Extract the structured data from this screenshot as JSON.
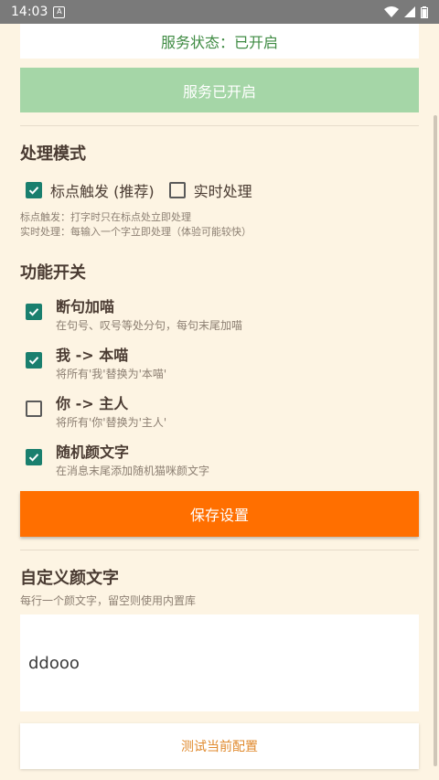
{
  "status_bar": {
    "time": "14:03",
    "notification_icon": "A"
  },
  "service": {
    "status_text": "服务状态：已开启",
    "button_label": "服务已开启"
  },
  "mode": {
    "title": "处理模式",
    "options": [
      {
        "label": "标点触发 (推荐)",
        "checked": true
      },
      {
        "label": "实时处理",
        "checked": false
      }
    ],
    "hints": [
      "标点触发：打字时只在标点处立即处理",
      "实时处理：每输入一个字立即处理（体验可能较快）"
    ]
  },
  "features": {
    "title": "功能开关",
    "items": [
      {
        "title": "断句加喵",
        "desc": "在句号、叹号等处分句，每句末尾加喵",
        "checked": true
      },
      {
        "title": "我 -> 本喵",
        "desc": "将所有'我'替换为'本喵'",
        "checked": true
      },
      {
        "title": "你 -> 主人",
        "desc": "将所有'你'替换为'主人'",
        "checked": false
      },
      {
        "title": "随机颜文字",
        "desc": "在消息末尾添加随机猫咪颜文字",
        "checked": true
      }
    ]
  },
  "save_button": "保存设置",
  "custom": {
    "title": "自定义颜文字",
    "hint": "每行一个颜文字，留空则使用内置库",
    "value": "ddooo"
  },
  "test_button": "测试当前配置",
  "colors": {
    "background": "#fdf4e3",
    "status_green": "#3f8b43",
    "service_button": "#a5d6a7",
    "checkbox": "#1a7f6e",
    "save_button": "#ff6f00",
    "test_text": "#e08a2e"
  }
}
